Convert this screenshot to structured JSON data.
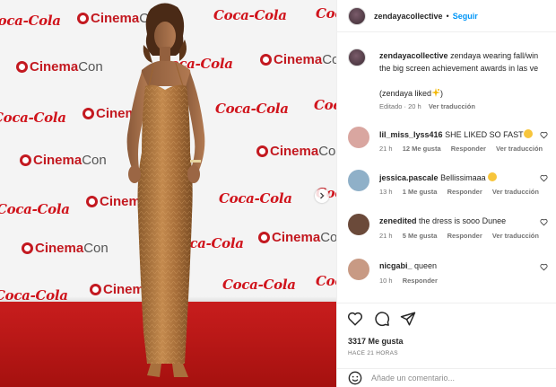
{
  "photo": {
    "logos_cocacola": [
      "Coca-Cola",
      "Coca-Cola",
      "Coca-Cola",
      "Coca-Cola",
      "Coca-Cola",
      "Coca-Cola",
      "Coca-Cola",
      "Coca-Cola",
      "Coca-Cola",
      "Coca-Cola",
      "Coca-Cola",
      "Coca-Cola",
      "Coca-Cola",
      "Coca-Cola"
    ],
    "logo_cinema": "Cinema",
    "logo_con": "Con",
    "next_icon": "chevron-right-icon",
    "carpet_color": "#c0181a"
  },
  "header": {
    "username": "zendayacollective",
    "separator": "•",
    "follow_label": "Seguir"
  },
  "caption": {
    "username": "zendayacollective",
    "text_line1": "zendaya wearing fall/win",
    "text_line2": "the big screen achievement awards in las ve",
    "liked": "(zendaya liked",
    "liked_close": ")",
    "meta_edited": "Editado",
    "meta_time": "20 h",
    "meta_translate": "Ver traducción"
  },
  "comments": [
    {
      "username": "lil_miss_lyss416",
      "text": "SHE LIKED SO FAST",
      "emoji": "star-struck-emoji",
      "time": "21 h",
      "likes": "12 Me gusta",
      "reply": "Responder",
      "translate": "Ver traducción",
      "avatar_color": "#d9a6a0"
    },
    {
      "username": "jessica.pascale",
      "text": "Bellissimaaa",
      "emoji": "heart-eyes-emoji",
      "time": "13 h",
      "likes": "1 Me gusta",
      "reply": "Responder",
      "translate": "Ver traducción",
      "avatar_color": "#8fb0c8"
    },
    {
      "username": "zenedited",
      "text": "the dress is sooo Dunee",
      "emoji": "",
      "time": "21 h",
      "likes": "5 Me gusta",
      "reply": "Responder",
      "translate": "Ver traducción",
      "avatar_color": "#6b4a3a"
    },
    {
      "username": "nicgabi_",
      "text": "queen",
      "emoji": "",
      "time": "10 h",
      "likes": "",
      "reply": "Responder",
      "translate": "",
      "avatar_color": "#c89a84"
    }
  ],
  "actions": {
    "like_icon": "heart-icon",
    "comment_icon": "comment-icon",
    "share_icon": "share-icon",
    "likes_count": "3317 Me gusta",
    "time_ago": "HACE 21 HORAS"
  },
  "composer": {
    "emoji_icon": "smiley-icon",
    "placeholder": "Añade un comentario..."
  },
  "colors": {
    "accent": "#0095f6",
    "muted": "#737373",
    "text": "#262626",
    "brand_red": "#d0141c"
  }
}
